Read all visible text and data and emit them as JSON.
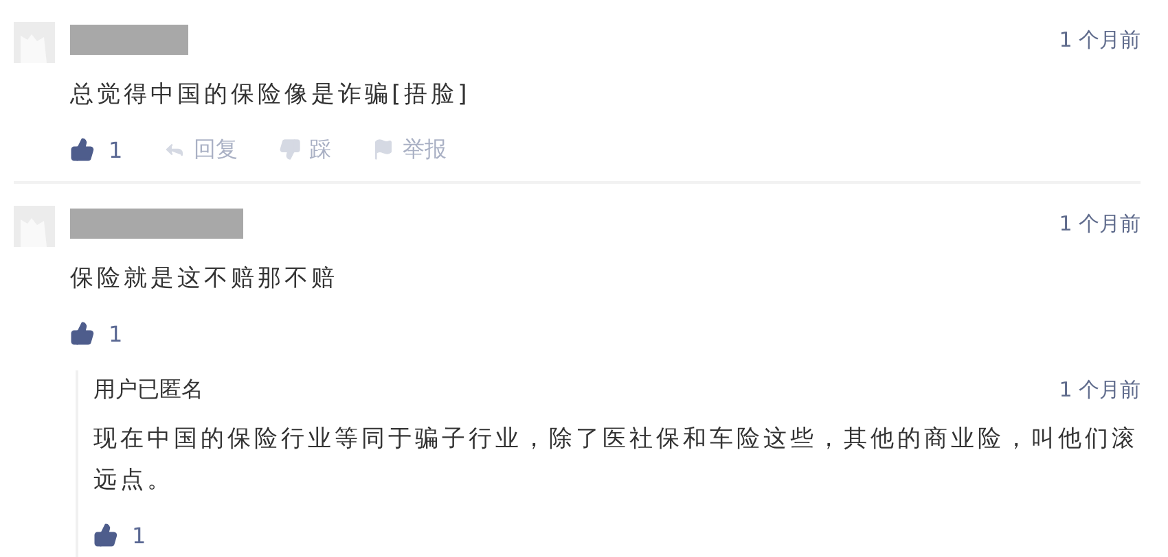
{
  "comments": [
    {
      "time": "1 个月前",
      "text": "总觉得中国的保险像是诈骗[捂脸]",
      "likes": "1",
      "actions": [
        {
          "kind": "reply",
          "label": "回复"
        },
        {
          "kind": "dislike",
          "label": "踩"
        },
        {
          "kind": "report",
          "label": "举报"
        }
      ]
    },
    {
      "time": "1 个月前",
      "text": "保险就是这不赔那不赔",
      "likes": "1",
      "replies": [
        {
          "author": "用户已匿名",
          "time": "1 个月前",
          "text": "现在中国的保险行业等同于骗子行业，除了医社保和车险这些，其他的商业险，叫他们滚远点。",
          "likes": "1"
        }
      ]
    }
  ]
}
